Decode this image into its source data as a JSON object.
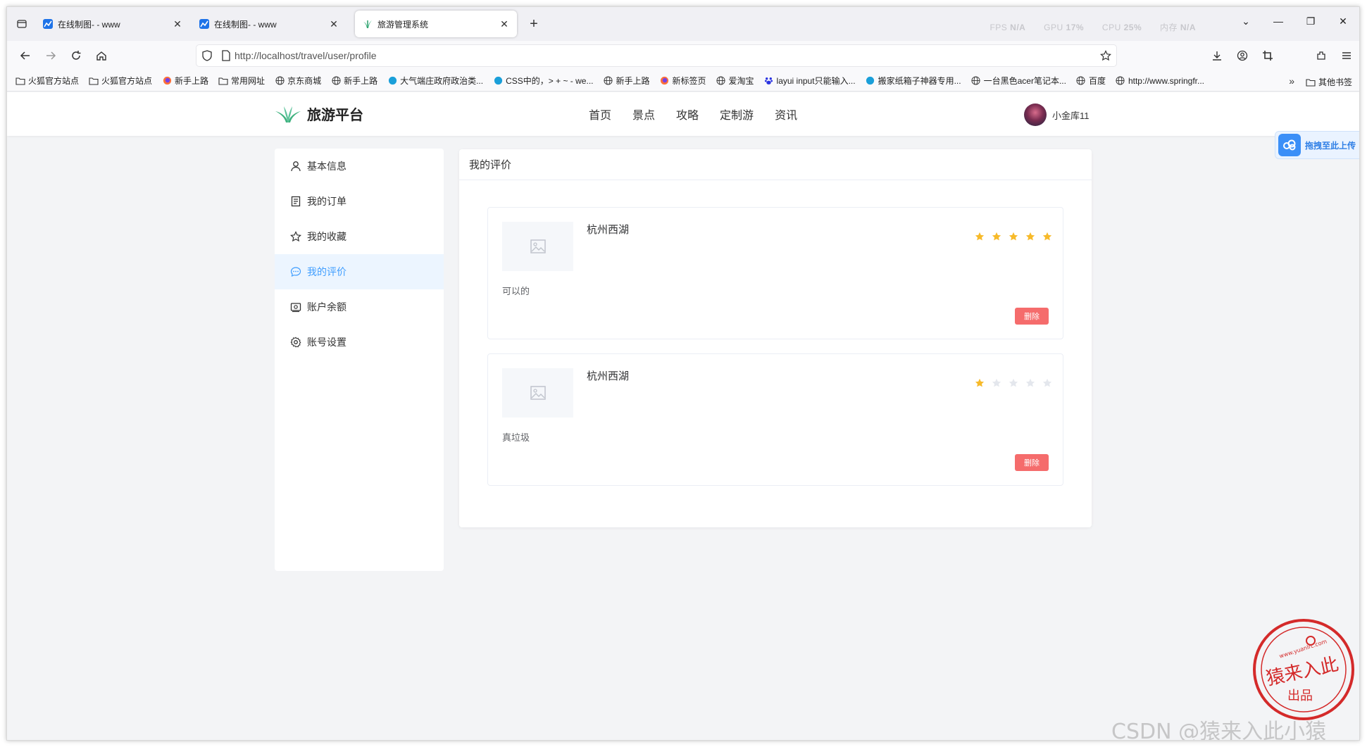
{
  "browser": {
    "tabs": [
      {
        "title": "在线制图- - www",
        "active": false
      },
      {
        "title": "在线制图- - www",
        "active": false
      },
      {
        "title": "旅游管理系统",
        "active": true
      }
    ],
    "sys_info": [
      {
        "label": "FPS",
        "value": "N/A"
      },
      {
        "label": "GPU",
        "value": "17%"
      },
      {
        "label": "CPU",
        "value": "25%"
      },
      {
        "label": "内存",
        "value": "N/A"
      }
    ],
    "url": "http://localhost/travel/user/profile",
    "bookmarks": [
      {
        "label": "火狐官方站点",
        "icon": "folder-icon"
      },
      {
        "label": "火狐官方站点",
        "icon": "folder-icon"
      },
      {
        "label": "新手上路",
        "icon": "firefox-icon"
      },
      {
        "label": "常用网址",
        "icon": "folder-icon"
      },
      {
        "label": "京东商城",
        "icon": "globe-icon"
      },
      {
        "label": "新手上路",
        "icon": "globe-icon"
      },
      {
        "label": "大气端庄政府政治类...",
        "icon": "site-icon"
      },
      {
        "label": "CSS中的，> + ~ - we...",
        "icon": "site-icon"
      },
      {
        "label": "新手上路",
        "icon": "globe-icon"
      },
      {
        "label": "新标签页",
        "icon": "firefox-icon"
      },
      {
        "label": "爱淘宝",
        "icon": "globe-icon"
      },
      {
        "label": "layui input只能输入...",
        "icon": "baidu-icon"
      },
      {
        "label": "搬家纸箱子神器专用...",
        "icon": "site-icon"
      },
      {
        "label": "一台黑色acer笔记本...",
        "icon": "globe-icon"
      },
      {
        "label": "百度",
        "icon": "globe-icon"
      },
      {
        "label": "http://www.springfr...",
        "icon": "globe-icon"
      }
    ],
    "other_bookmarks": "其他书签"
  },
  "site": {
    "brand": "旅游平台",
    "menu": [
      "首页",
      "景点",
      "攻略",
      "定制游",
      "资讯"
    ],
    "username": "小金库11",
    "upload_widget": "拖拽至此上传"
  },
  "sidebar": {
    "items": [
      {
        "label": "基本信息",
        "icon": "user-icon",
        "active": false
      },
      {
        "label": "我的订单",
        "icon": "document-icon",
        "active": false
      },
      {
        "label": "我的收藏",
        "icon": "star-icon",
        "active": false
      },
      {
        "label": "我的评价",
        "icon": "chat-icon",
        "active": true
      },
      {
        "label": "账户余额",
        "icon": "wallet-icon",
        "active": false
      },
      {
        "label": "账号设置",
        "icon": "settings-icon",
        "active": false
      }
    ]
  },
  "reviews_panel": {
    "title": "我的评价",
    "reviews": [
      {
        "spot": "杭州西湖",
        "rating": 5,
        "max_rating": 5,
        "comment": "可以的",
        "delete_label": "删除"
      },
      {
        "spot": "杭州西湖",
        "rating": 1,
        "max_rating": 5,
        "comment": "真垃圾",
        "delete_label": "删除"
      }
    ]
  },
  "colors": {
    "accent": "#409eff",
    "star_on": "#f7ba2a",
    "star_off": "#e4e7ed",
    "danger": "#f56c6c"
  },
  "watermarks": {
    "stamp_text": "猿来入此",
    "stamp_sub": "出品",
    "stamp_url": "www.yuanlrc.com",
    "csdn": "CSDN @猿来入此小猿"
  }
}
